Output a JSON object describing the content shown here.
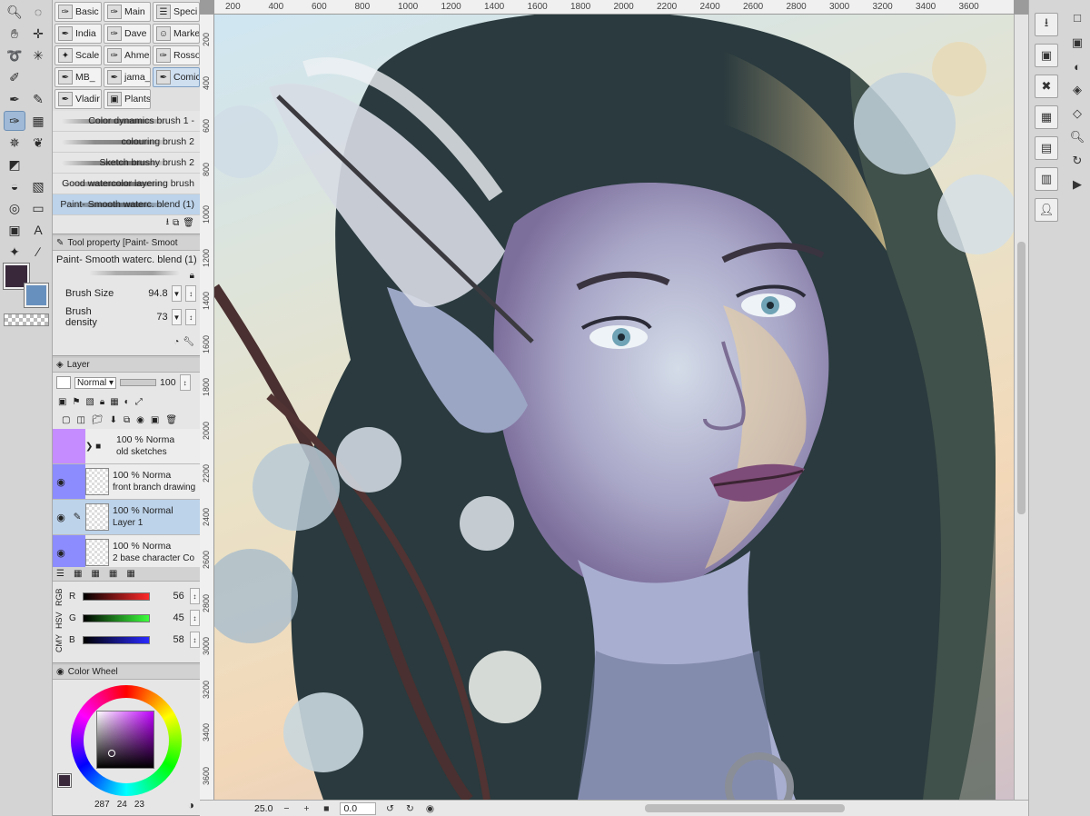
{
  "subtool_tabs": [
    {
      "label": "Basic",
      "icon": "brush-icon"
    },
    {
      "label": "Main",
      "icon": "brush-icon"
    },
    {
      "label": "Speci",
      "icon": "lines-icon"
    },
    {
      "label": "India",
      "icon": "pen-icon"
    },
    {
      "label": "Dave",
      "icon": "brush-icon"
    },
    {
      "label": "Marke",
      "icon": "avatar-icon"
    },
    {
      "label": "Scale",
      "icon": "sparkle-icon"
    },
    {
      "label": "Ahme",
      "icon": "brush-icon"
    },
    {
      "label": "Rosso",
      "icon": "brush-icon"
    },
    {
      "label": "MB_",
      "icon": "pen-icon"
    },
    {
      "label": "jama_",
      "icon": "pen-icon"
    },
    {
      "label": "Comic",
      "icon": "pen-icon"
    },
    {
      "label": "Vladir",
      "icon": "pen-icon"
    },
    {
      "label": "Plants",
      "icon": "image-icon"
    }
  ],
  "brush_list": [
    "Color dynamics brush 1 -",
    "colouring brush 2",
    "Sketch brushy brush 2",
    "Good watercolor layering brush",
    "Paint- Smooth waterc. blend (1)"
  ],
  "tool_property": {
    "title": "Tool property [Paint- Smoot",
    "brush_name": "Paint- Smooth waterc. blend (1)",
    "brush_size_label": "Brush Size",
    "brush_size_value": "94.8",
    "brush_density_label": "Brush density",
    "brush_density_value": "73"
  },
  "layer_panel": {
    "title": "Layer",
    "blend_mode": "Normal",
    "opacity": "100",
    "layers": [
      {
        "opacity_mode": "100 % Norma",
        "name": "old sketches",
        "tag_color": "#c58cff",
        "selected": false
      },
      {
        "opacity_mode": "100 % Norma",
        "name": "front branch drawing",
        "tag_color": "#8c8cff",
        "selected": false
      },
      {
        "opacity_mode": "100 % Normal",
        "name": "Layer 1",
        "tag_color": "",
        "selected": true
      },
      {
        "opacity_mode": "100 % Norma",
        "name": "2 base character Co",
        "tag_color": "#8c8cff",
        "selected": false
      }
    ]
  },
  "color_sliders": {
    "modes": [
      "RGB",
      "HSV",
      "CMY"
    ],
    "r": {
      "label": "R",
      "value": "56"
    },
    "g": {
      "label": "G",
      "value": "45"
    },
    "b": {
      "label": "B",
      "value": "58"
    }
  },
  "color_wheel": {
    "title": "Color Wheel",
    "h": "287",
    "s": "24",
    "v": "23"
  },
  "colors": {
    "main": "#38283a",
    "sub": "#6890be"
  },
  "ruler_top": [
    "200",
    "400",
    "600",
    "800",
    "1000",
    "1200",
    "1400",
    "1600",
    "1800",
    "2000",
    "2200",
    "2400",
    "2600",
    "2800",
    "3000",
    "3200",
    "3400",
    "3600"
  ],
  "ruler_left": [
    "200",
    "400",
    "600",
    "800",
    "1000",
    "1200",
    "1400",
    "1600",
    "1800",
    "2000",
    "2200",
    "2400",
    "2600",
    "2800",
    "3000",
    "3200",
    "3400",
    "3600"
  ],
  "status": {
    "zoom": "25.0",
    "rotation": "0.0"
  }
}
